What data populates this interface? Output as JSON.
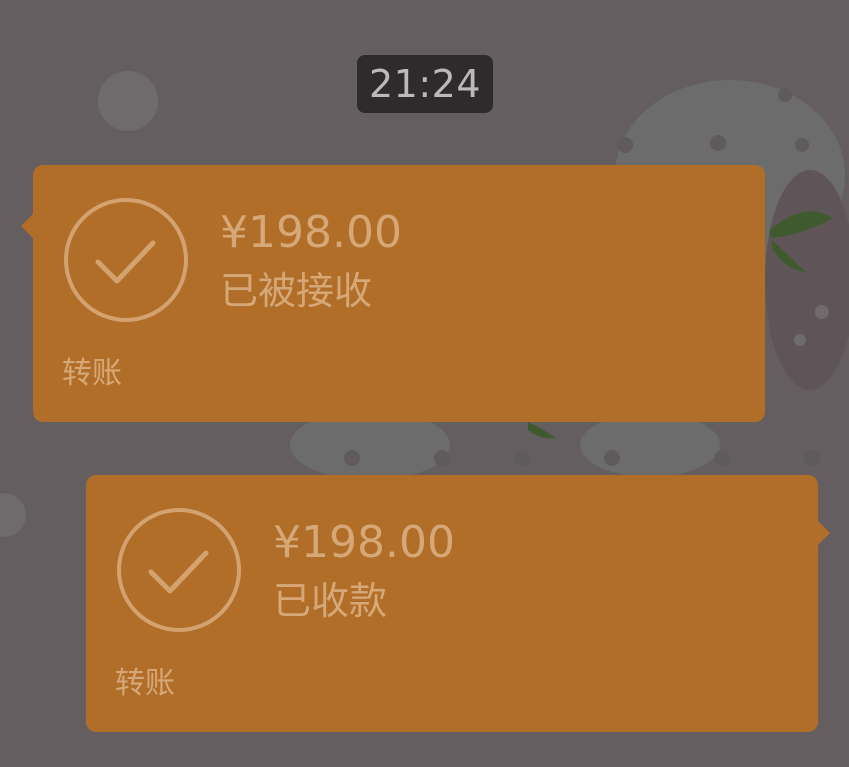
{
  "chat": {
    "timestamp": "21:24",
    "messages": [
      {
        "type": "transfer",
        "direction": "incoming",
        "amount": "¥198.00",
        "status": "已被接收",
        "label": "转账",
        "icon": "check-circle-icon"
      },
      {
        "type": "transfer",
        "direction": "outgoing",
        "amount": "¥198.00",
        "status": "已收款",
        "label": "转账",
        "icon": "check-circle-icon"
      }
    ]
  },
  "colors": {
    "background": "#645e60",
    "card": "#b06e28",
    "card_text": "#d7a877",
    "time_pill": "#2d2b2c"
  }
}
